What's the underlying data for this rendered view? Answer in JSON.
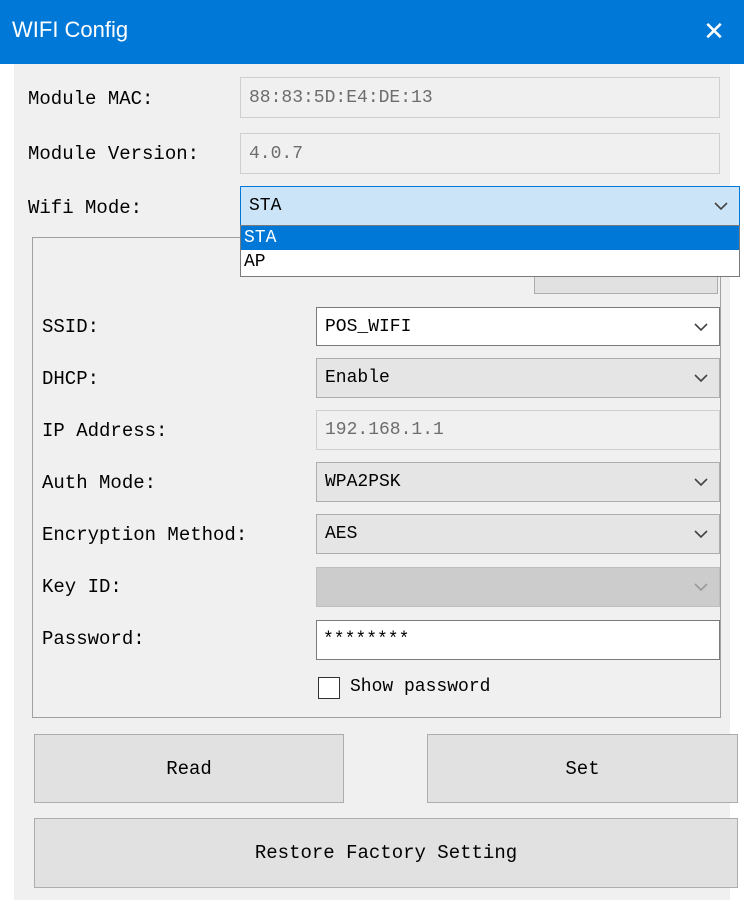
{
  "window": {
    "title": "WIFI Config",
    "close_icon": "close-icon"
  },
  "module": {
    "mac_label": "Module MAC:",
    "mac_value": "88:83:5D:E4:DE:13",
    "version_label": "Module Version:",
    "version_value": "4.0.7"
  },
  "wifi_mode": {
    "label": "Wifi Mode:",
    "value": "STA",
    "options": [
      "STA",
      "AP"
    ]
  },
  "network": {
    "ssid_label": "SSID:",
    "ssid_value": "POS_WIFI",
    "dhcp_label": "DHCP:",
    "dhcp_value": "Enable",
    "ip_label": "IP Address:",
    "ip_value": "192.168.1.1",
    "auth_label": "Auth Mode:",
    "auth_value": "WPA2PSK",
    "enc_label": "Encryption Method:",
    "enc_value": "AES",
    "keyid_label": "Key ID:",
    "keyid_value": "",
    "password_label": "Password:",
    "password_value": "********",
    "show_password_label": "Show password"
  },
  "buttons": {
    "read": "Read",
    "set": "Set",
    "restore": "Restore Factory Setting"
  },
  "colors": {
    "accent": "#0078d7",
    "window_bg": "#f0f0f0"
  }
}
